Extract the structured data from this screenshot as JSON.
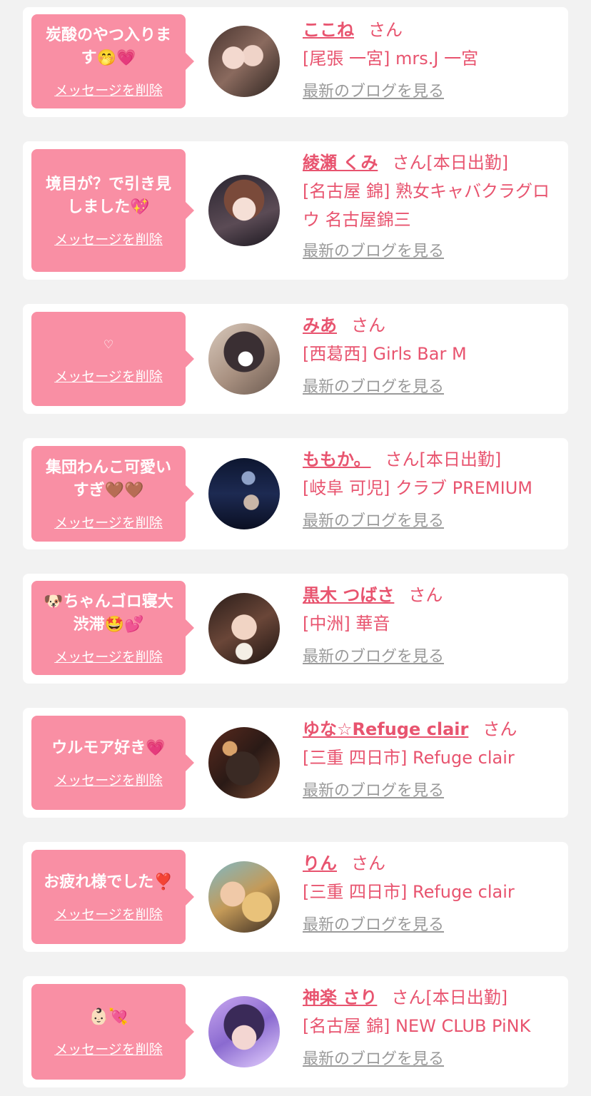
{
  "colors": {
    "accent": "#e8546f",
    "bubble": "#f98fa4",
    "card": "#ffffff",
    "background": "#f2f2f2",
    "link_gray": "#9a9a9a"
  },
  "labels": {
    "delete": "メッセージを削除",
    "blog": "最新のブログを見る",
    "honorific": "さん"
  },
  "messages": [
    {
      "text": "炭酸のやつ入ります🤭💗",
      "name": "ここね",
      "status": "",
      "shop": "[尾張 一宮] mrs.J 一宮"
    },
    {
      "text": "境目が？で引き見しました💖",
      "name": "綾瀬 くみ",
      "status": "[本日出勤]",
      "shop": "[名古屋 錦] 熟女キャバクラグロウ 名古屋錦三"
    },
    {
      "text": "♡",
      "name": "みあ",
      "status": "",
      "shop": "[西葛西] Girls Bar M"
    },
    {
      "text": "集団わんこ可愛いすぎ🤎🤎",
      "name": "ももか。",
      "status": "[本日出勤]",
      "shop": "[岐阜 可児] クラブ PREMIUM"
    },
    {
      "text": "🐶ちゃんゴロ寝大渋滞🤩💕",
      "name": "黒木 つばさ",
      "status": "",
      "shop": "[中洲] 華音"
    },
    {
      "text": "ウルモア好き💗",
      "name": "ゆな☆Refuge clair",
      "status": "",
      "shop": "[三重 四日市] Refuge clair"
    },
    {
      "text": "お疲れ様でした❣️",
      "name": "りん",
      "status": "",
      "shop": "[三重 四日市] Refuge clair"
    },
    {
      "text": "👶🏻💘",
      "name": "神楽 さり",
      "status": "[本日出勤]",
      "shop": "[名古屋 錦] NEW CLUB PiNK"
    }
  ]
}
